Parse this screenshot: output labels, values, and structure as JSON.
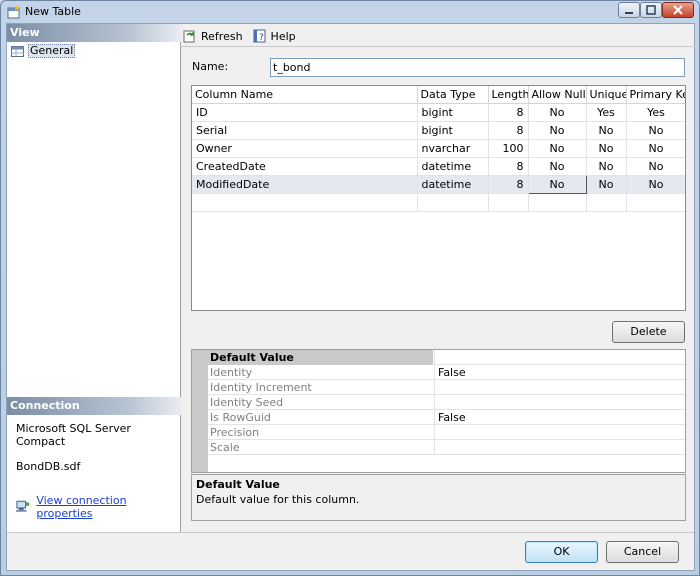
{
  "window": {
    "title": "New Table"
  },
  "left_pane": {
    "view_header": "View",
    "nav_items": [
      {
        "label": "General",
        "icon": "table-properties-icon"
      }
    ],
    "connection_header": "Connection",
    "server": "Microsoft SQL Server Compact",
    "database": "BondDB.sdf",
    "connection_link": "View connection properties"
  },
  "toolbar": {
    "refresh_label": "Refresh",
    "help_label": "Help"
  },
  "form": {
    "name_label": "Name:",
    "name_value": "t_bond"
  },
  "columns_grid": {
    "headers": [
      "Column Name",
      "Data Type",
      "Length",
      "Allow Nulls",
      "Unique",
      "Primary Key"
    ],
    "rows": [
      [
        "ID",
        "bigint",
        "8",
        "No",
        "Yes",
        "Yes"
      ],
      [
        "Serial",
        "bigint",
        "8",
        "No",
        "No",
        "No"
      ],
      [
        "Owner",
        "nvarchar",
        "100",
        "No",
        "No",
        "No"
      ],
      [
        "CreatedDate",
        "datetime",
        "8",
        "No",
        "No",
        "No"
      ],
      [
        "ModifiedDate",
        "datetime",
        "8",
        "No",
        "No",
        "No"
      ]
    ],
    "selected_row": 4
  },
  "delete_label": "Delete",
  "properties": {
    "header": "Default Value",
    "rows": [
      {
        "name": "Identity",
        "value": "False"
      },
      {
        "name": "Identity Increment",
        "value": ""
      },
      {
        "name": "Identity Seed",
        "value": ""
      },
      {
        "name": "Is RowGuid",
        "value": "False"
      },
      {
        "name": "Precision",
        "value": ""
      },
      {
        "name": "Scale",
        "value": ""
      }
    ]
  },
  "description": {
    "title": "Default Value",
    "text": "Default value for this column."
  },
  "buttons": {
    "ok": "OK",
    "cancel": "Cancel"
  }
}
